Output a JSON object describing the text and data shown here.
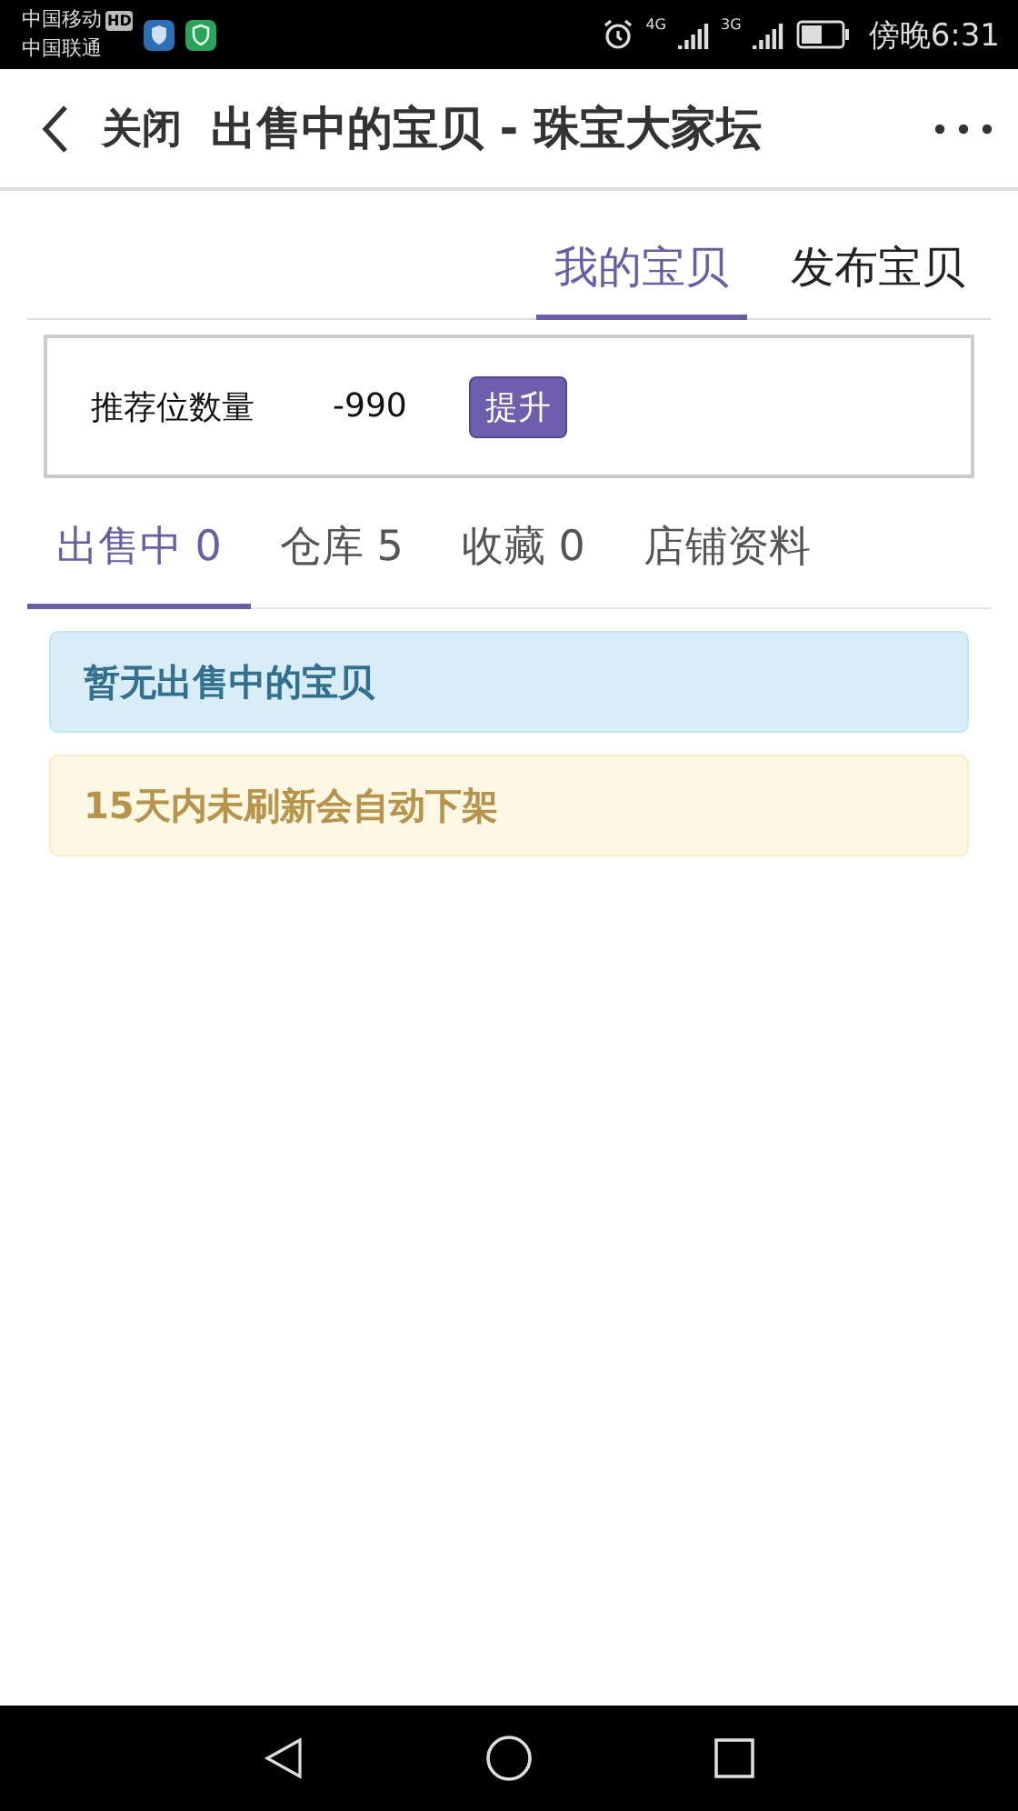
{
  "status_bar": {
    "carriers": [
      "中国移动",
      "中国联通"
    ],
    "hd_badge": "HD",
    "networks": [
      "4G",
      "3G"
    ],
    "time": "傍晚6:31"
  },
  "header": {
    "close": "关闭",
    "title": "出售中的宝贝 - 珠宝大家坛"
  },
  "top_tabs": [
    {
      "label": "我的宝贝",
      "selected": true
    },
    {
      "label": "发布宝贝",
      "selected": false
    }
  ],
  "promo": {
    "label": "推荐位数量",
    "value": "-990",
    "button": "提升"
  },
  "tabs": [
    {
      "label": "出售中 0",
      "selected": true
    },
    {
      "label": "仓库 5",
      "selected": false
    },
    {
      "label": "收藏 0",
      "selected": false
    },
    {
      "label": "店铺资料",
      "selected": false
    }
  ],
  "alerts": [
    {
      "kind": "info",
      "text": "暂无出售中的宝贝"
    },
    {
      "kind": "warning",
      "text": "15天内未刷新会自动下架"
    }
  ]
}
